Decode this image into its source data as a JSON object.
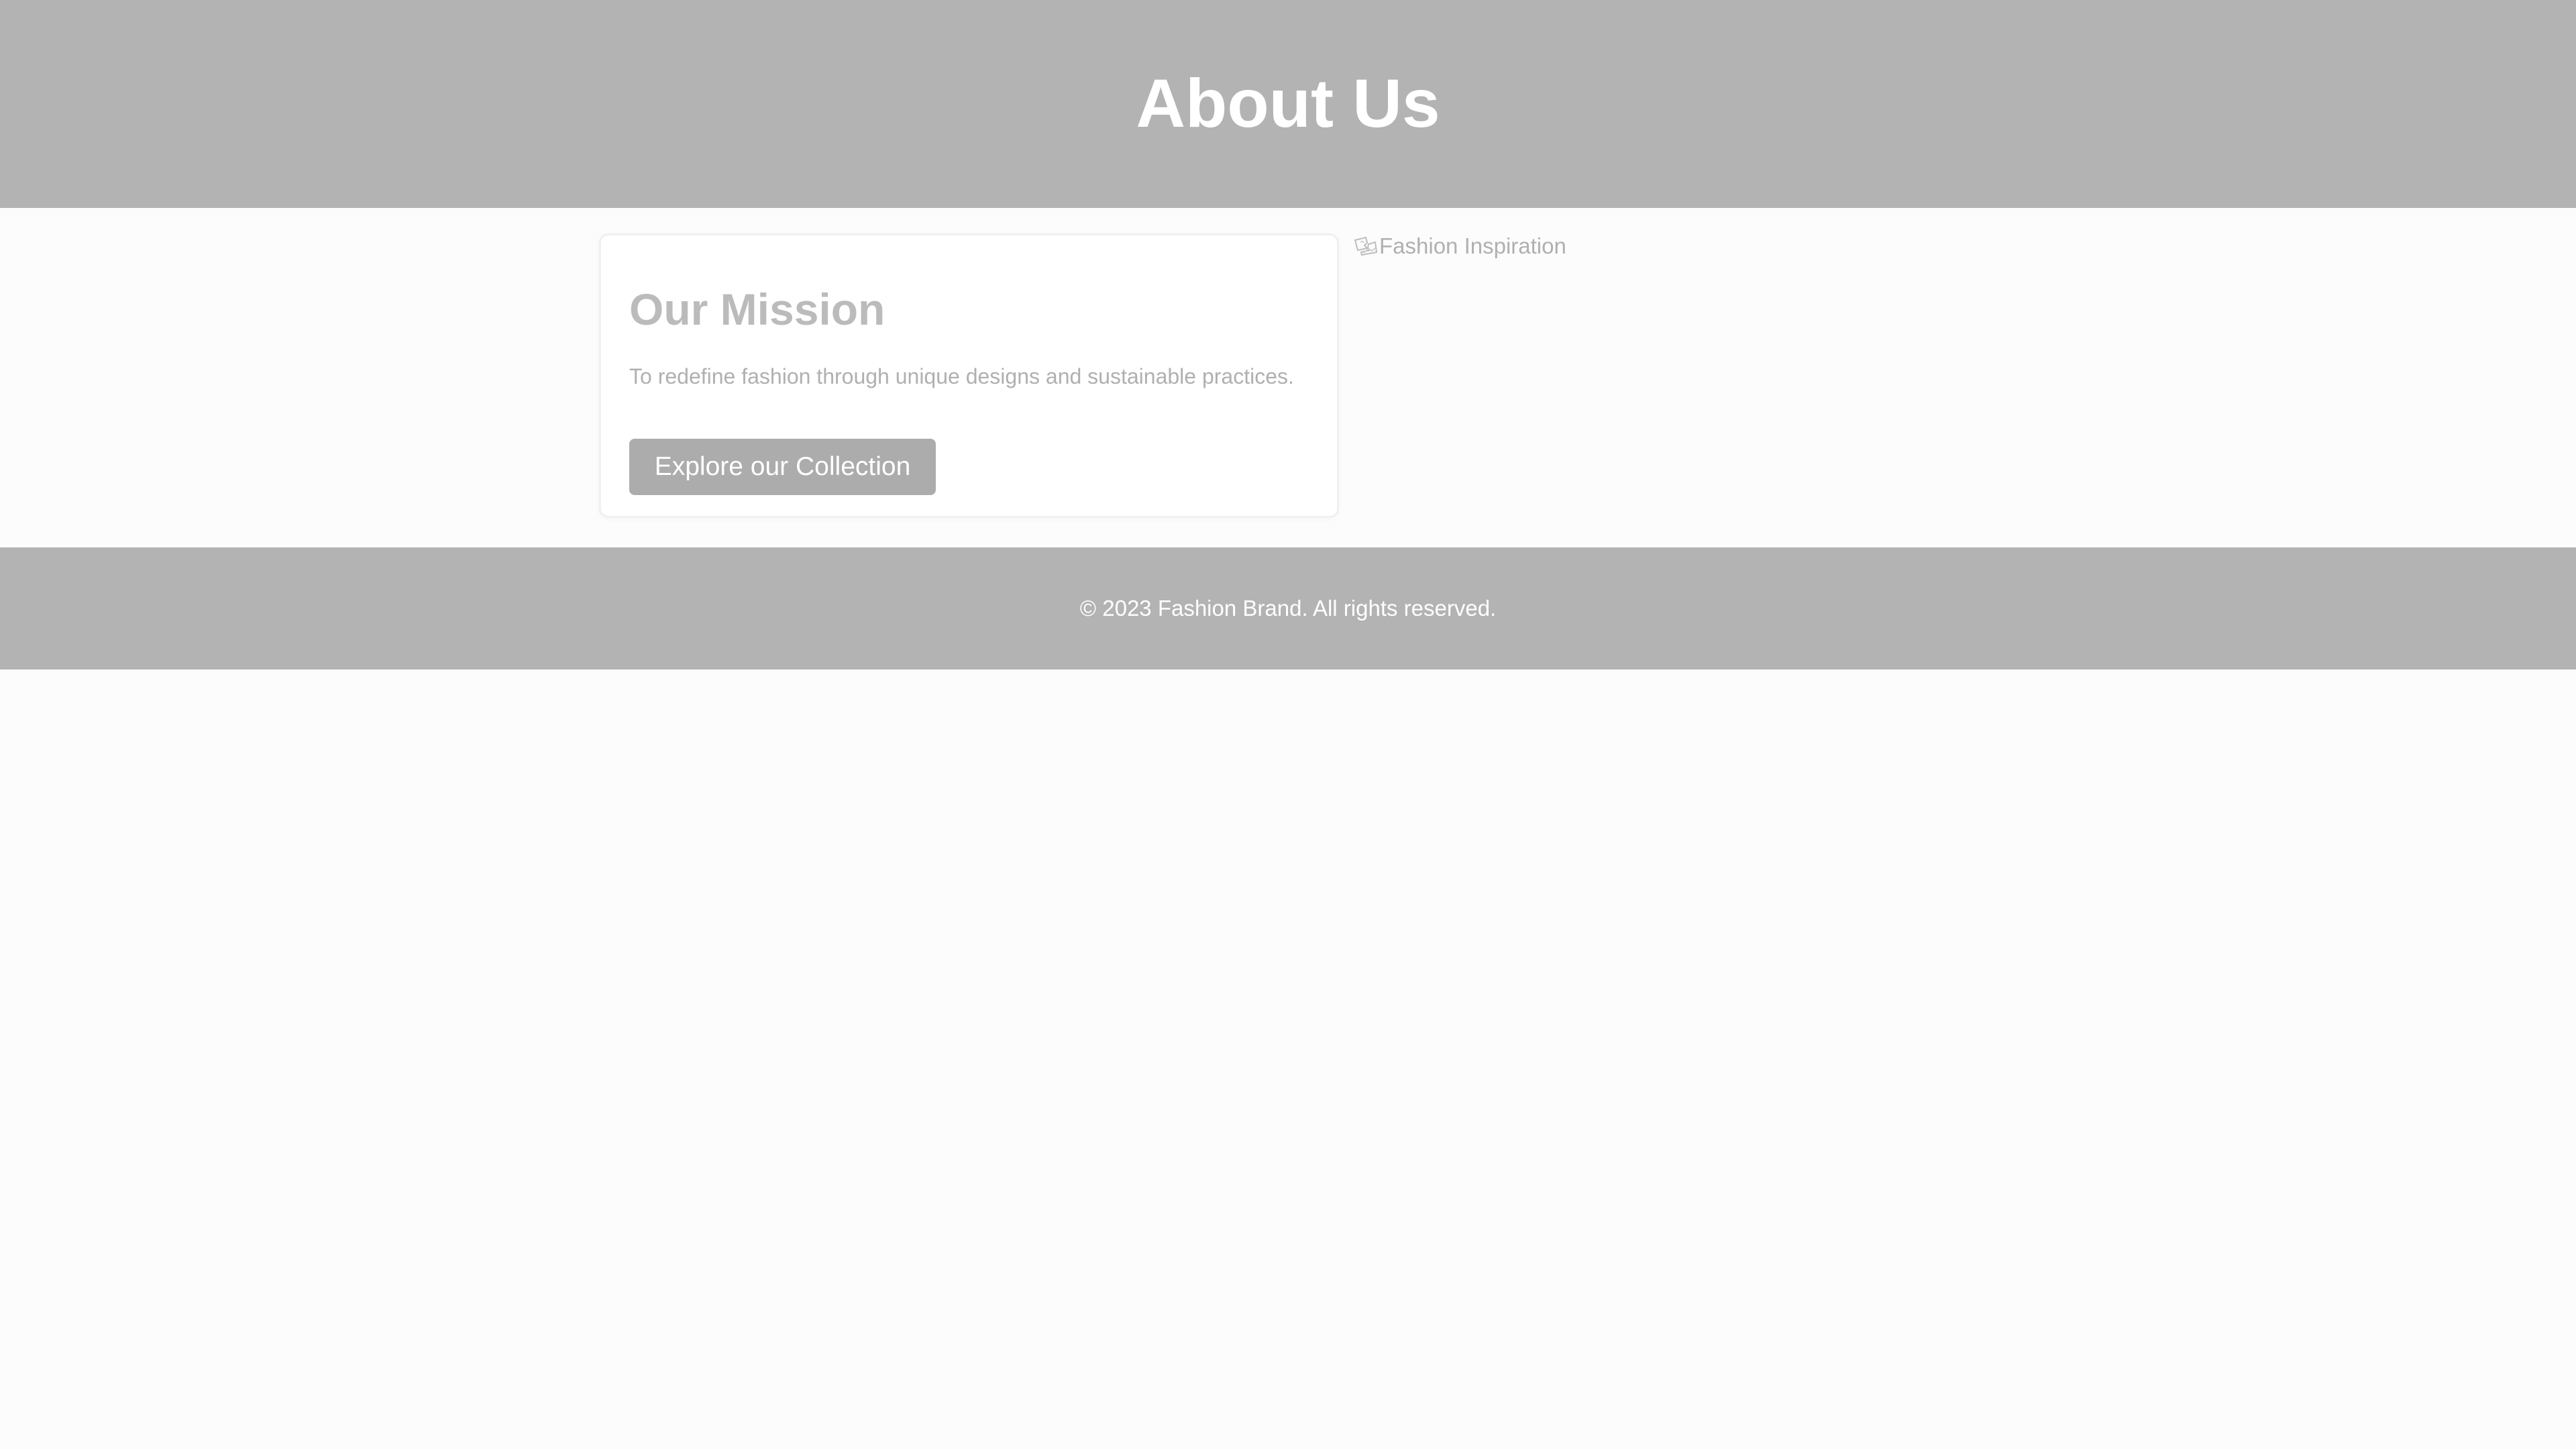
{
  "header": {
    "title": "About Us"
  },
  "mission": {
    "title": "Our Mission",
    "text": "To redefine fashion through unique designs and sustainable practices.",
    "button_label": "Explore our Collection"
  },
  "image": {
    "alt": "Fashion Inspiration",
    "icon": "broken-image-icon"
  },
  "footer": {
    "copyright": "© 2023 Fashion Brand. All rights reserved."
  },
  "colors": {
    "header_bg": "#b3b3b3",
    "footer_bg": "#b3b3b3",
    "button_bg": "#acacac",
    "page_bg": "#fcfcfc"
  }
}
